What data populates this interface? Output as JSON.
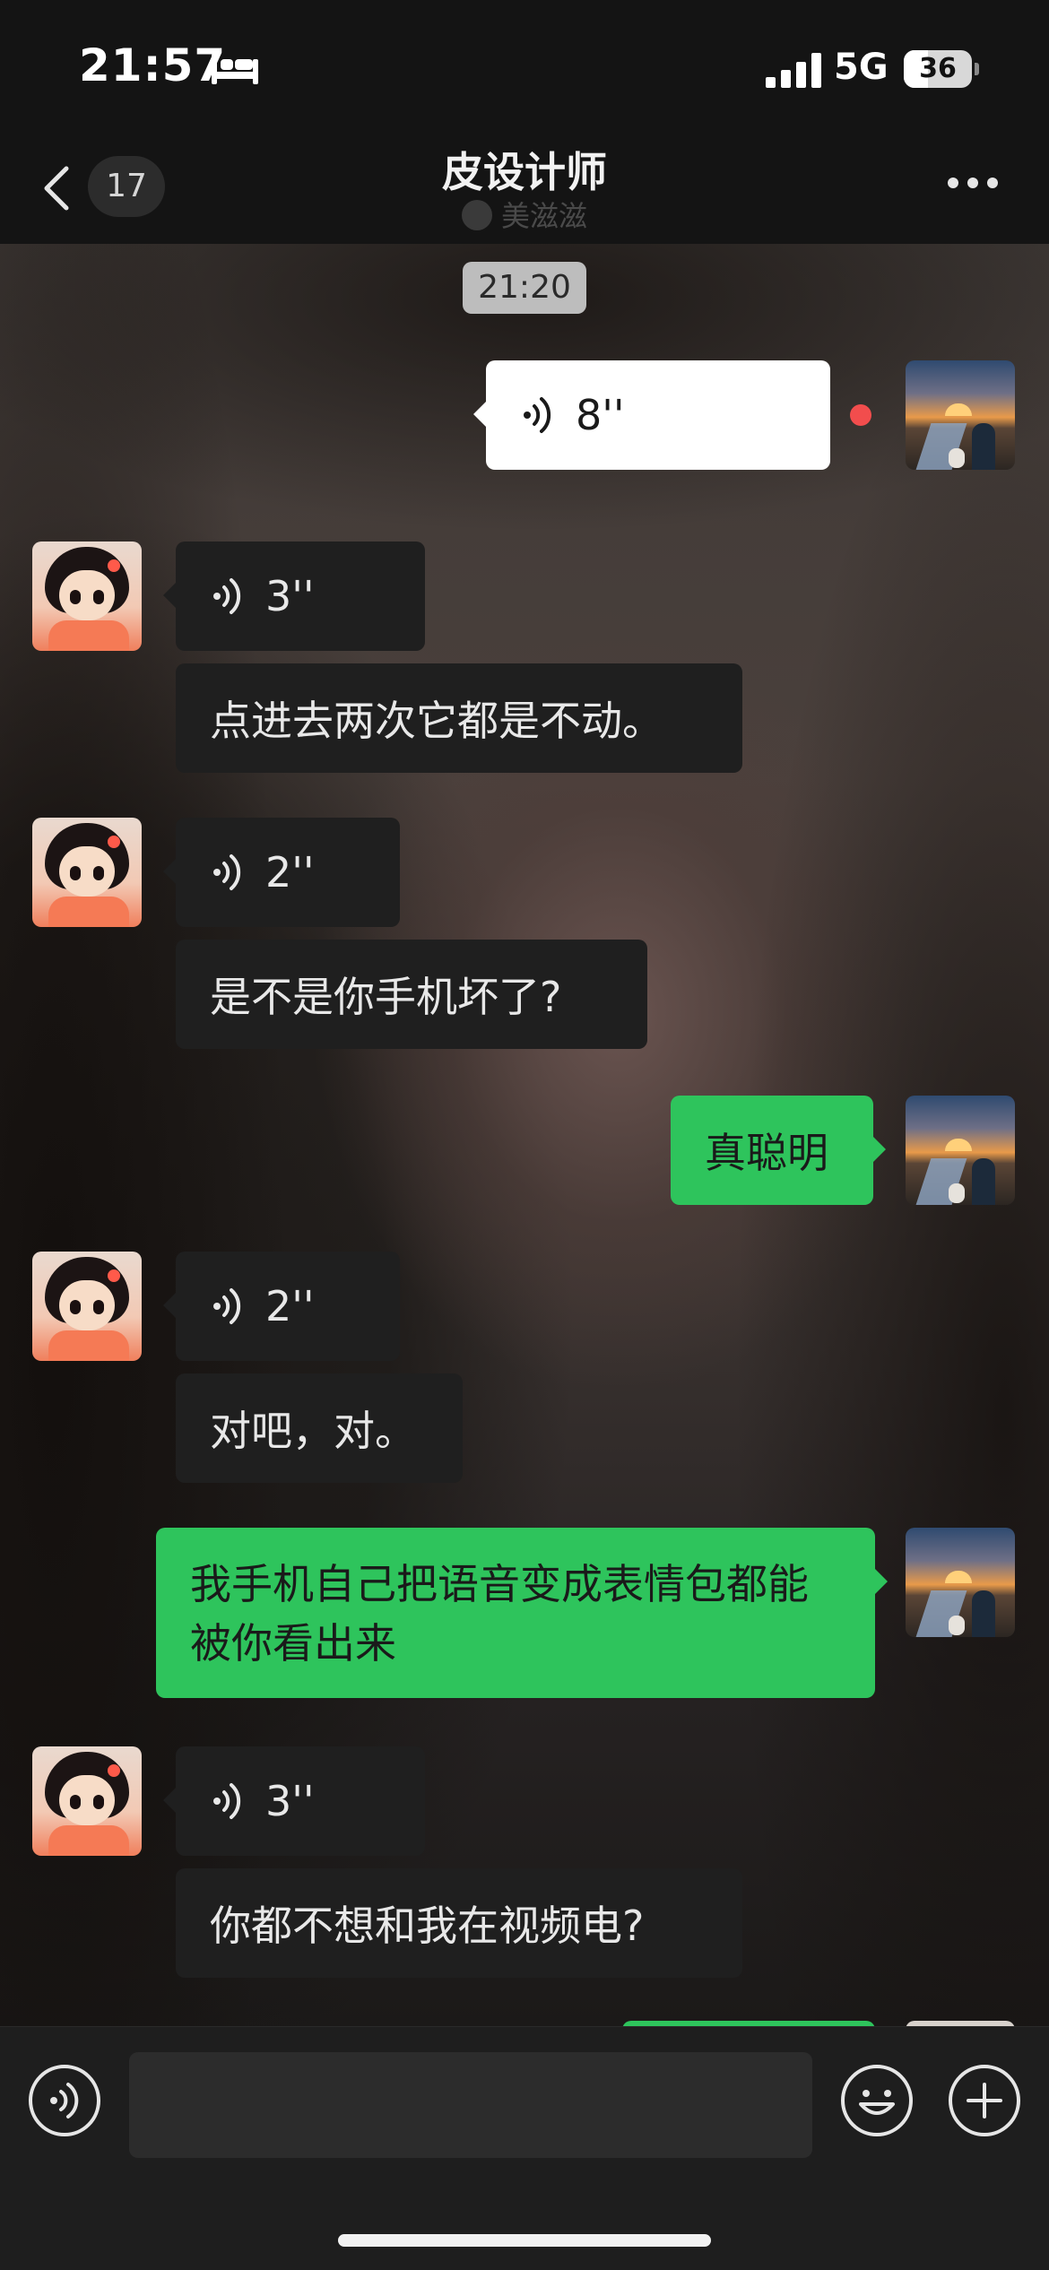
{
  "status_bar": {
    "time": "21:57",
    "network": "5G",
    "battery_level": "36",
    "battery_fraction": 0.36
  },
  "nav": {
    "unread_count": "17",
    "title": "皮设计师",
    "subtitle": "美滋滋"
  },
  "messages": {
    "timestamp": "21:20",
    "m1_voice_out": "8''",
    "m2_voice_in": "3''",
    "m3_text_in": "点进去两次它都是不动。",
    "m4_voice_in": "2''",
    "m5_text_in": "是不是你手机坏了?",
    "m6_text_out": "真聪明",
    "m7_voice_in": "2''",
    "m8_text_in": "对吧，对。",
    "m9_text_out": "我手机自己把语音变成表情包都能被你看出来",
    "m10_voice_in": "3''",
    "m11_text_in": "你都不想和我在视频电?"
  },
  "colors": {
    "outgoing_bubble": "#2ec45c",
    "incoming_bubble": "#1f1f1f",
    "unread_dot": "#f24d4d"
  },
  "icons": [
    "bed-icon",
    "signal-icon",
    "battery-icon",
    "back-icon",
    "more-icon",
    "voice-icon",
    "voice-toggle-icon",
    "emoji-icon",
    "plus-icon"
  ]
}
